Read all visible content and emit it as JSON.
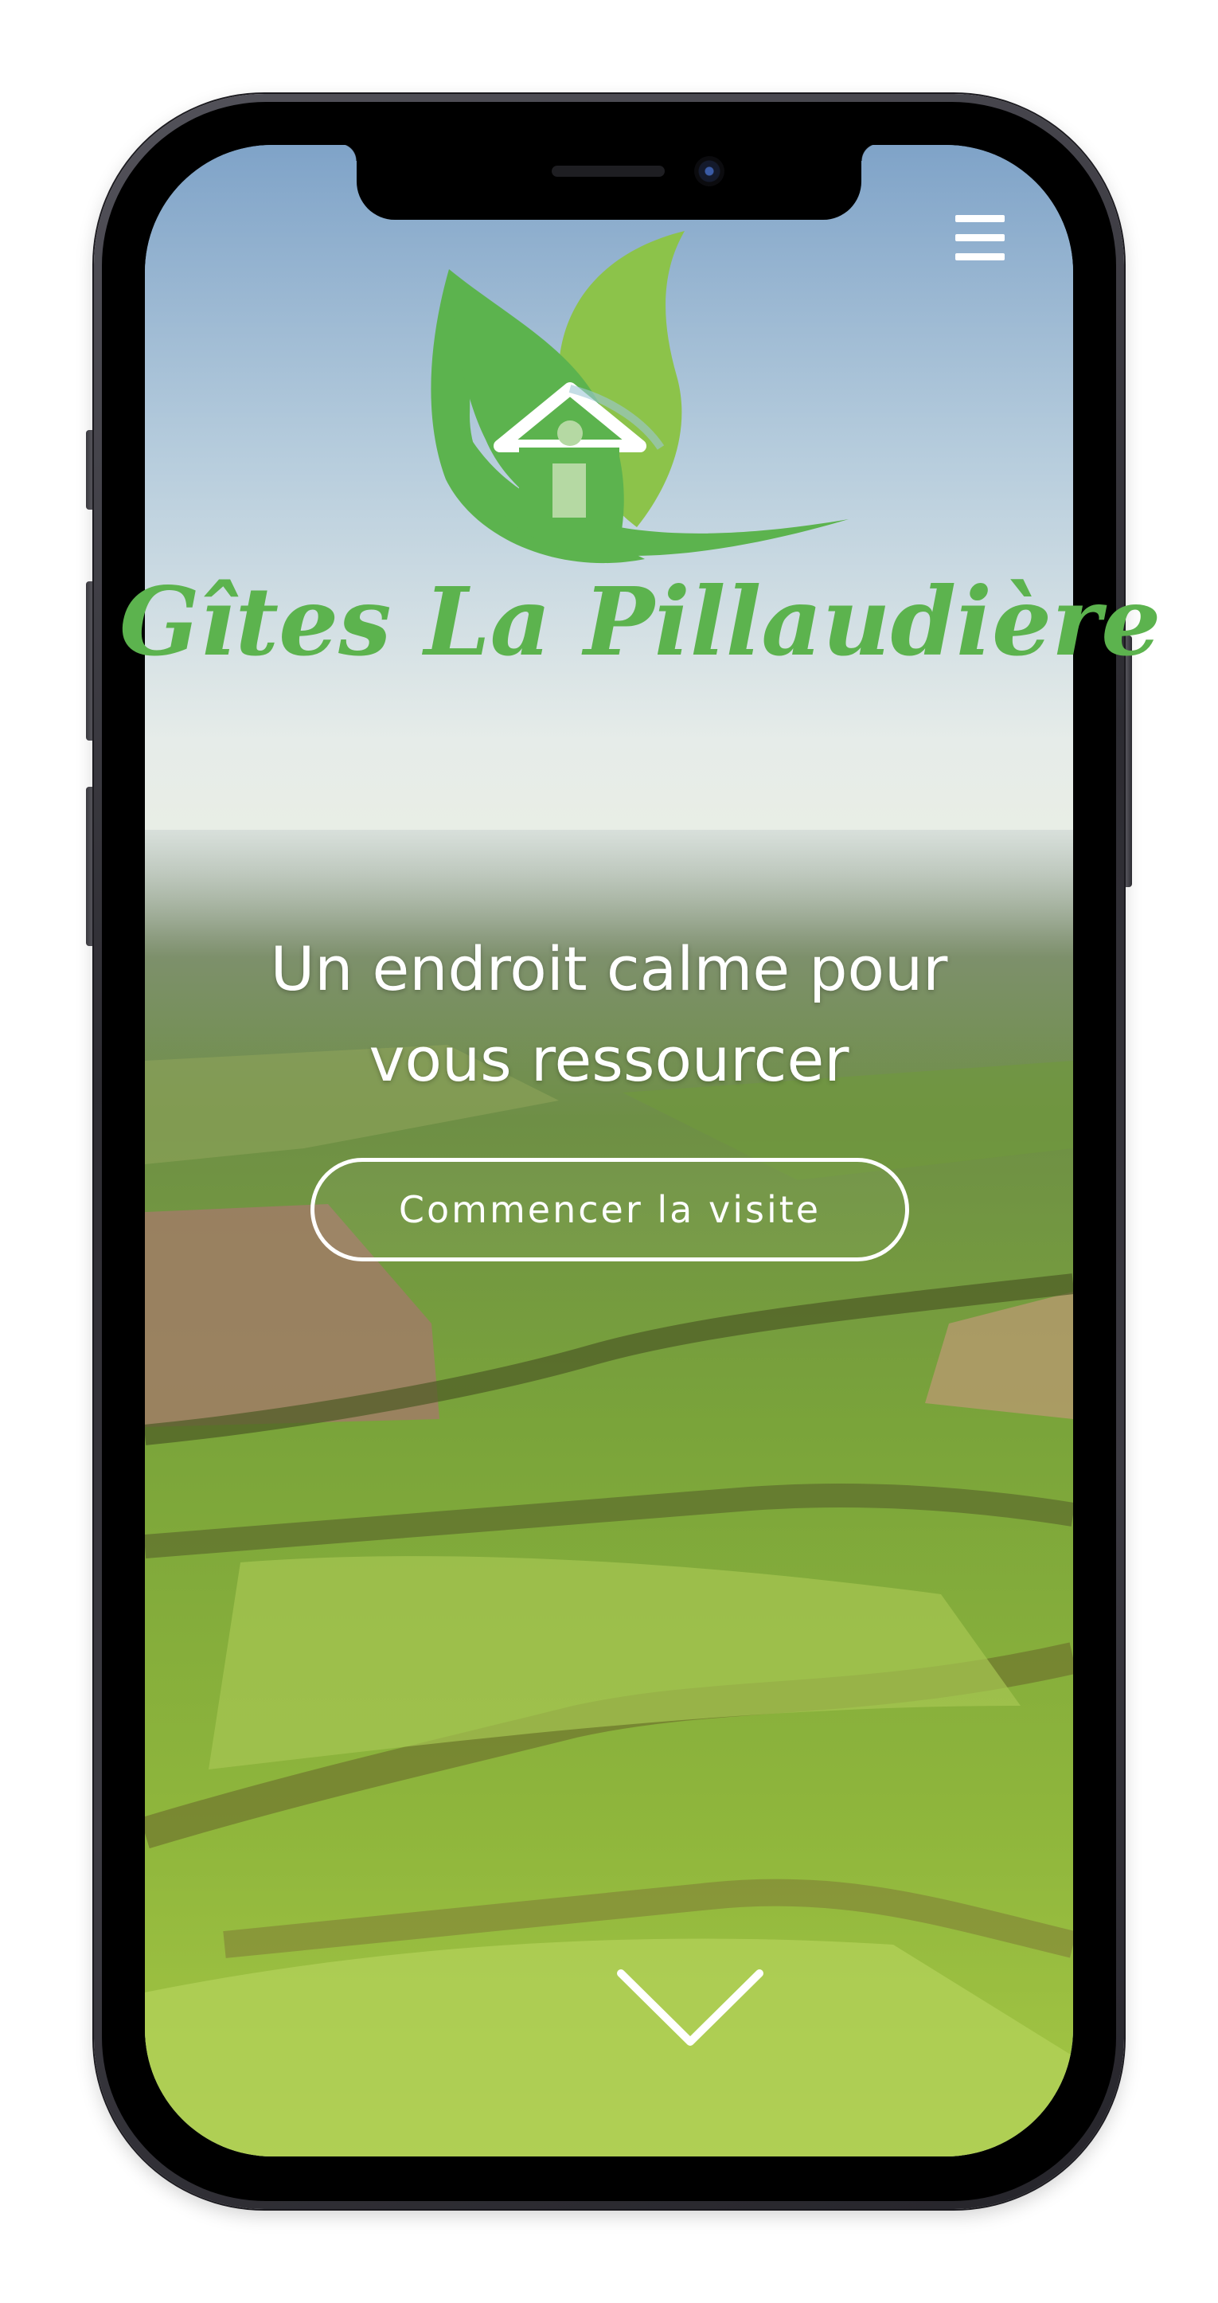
{
  "site": {
    "brand_name": "Gîtes La Pillaudière"
  },
  "hero": {
    "heading": "Un endroit calme pour vous ressourcer",
    "cta_label": "Commencer la visite"
  },
  "icons": {
    "menu": "hamburger-menu-icon",
    "logo": "leaf-house-logo-icon",
    "scroll": "chevron-down-icon"
  },
  "colors": {
    "brand_green": "#5cb34e",
    "light_green": "#8cc34a",
    "text_on_image": "#ffffff"
  }
}
